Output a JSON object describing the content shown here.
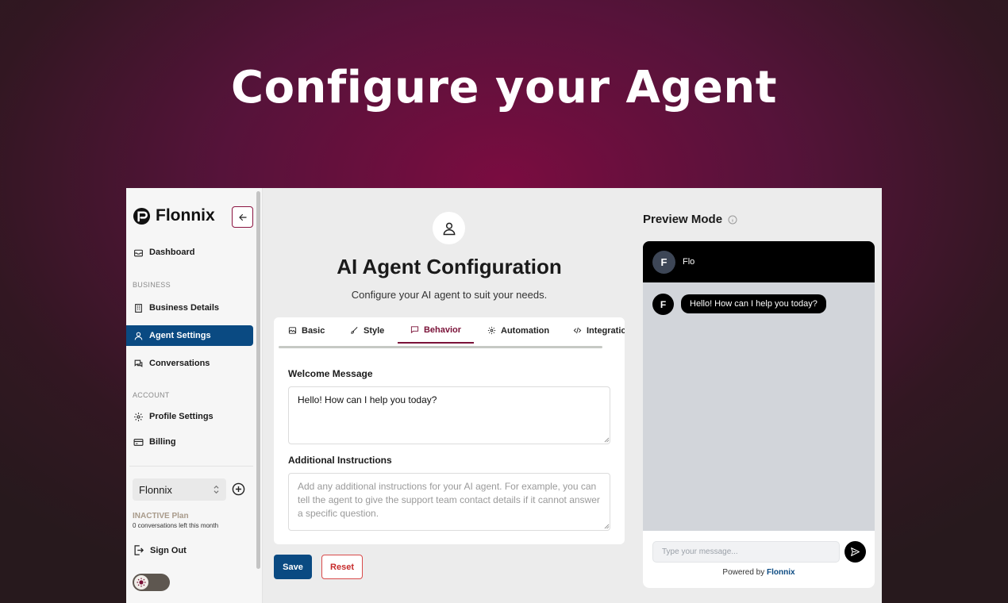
{
  "hero": {
    "title": "Configure your Agent"
  },
  "sidebar": {
    "brand": "Flonnix",
    "dashboard": "Dashboard",
    "business_section": "BUSINESS",
    "business_details": "Business Details",
    "agent_settings": "Agent Settings",
    "conversations": "Conversations",
    "account_section": "ACCOUNT",
    "profile_settings": "Profile Settings",
    "billing": "Billing",
    "org_selected": "Flonnix",
    "plan_name": "INACTIVE Plan",
    "plan_sub": "0 conversations left this month",
    "sign_out": "Sign Out"
  },
  "main": {
    "title": "AI Agent Configuration",
    "subtitle": "Configure your AI agent to suit your needs.",
    "tabs": [
      {
        "label": "Basic",
        "icon": "image-icon"
      },
      {
        "label": "Style",
        "icon": "brush-icon"
      },
      {
        "label": "Behavior",
        "icon": "message-icon",
        "active": true
      },
      {
        "label": "Automation",
        "icon": "gear-icon"
      },
      {
        "label": "Integratio",
        "icon": "code-icon"
      }
    ],
    "welcome_label": "Welcome Message",
    "welcome_value": "Hello! How can I help you today?",
    "instructions_label": "Additional Instructions",
    "instructions_placeholder": "Add any additional instructions for your AI agent. For example, you can tell the agent to give the support team contact details if it cannot answer a specific question.",
    "save_label": "Save",
    "reset_label": "Reset"
  },
  "preview": {
    "title": "Preview Mode",
    "agent_initial": "F",
    "agent_name": "Flo",
    "message": "Hello! How can I help you today?",
    "input_placeholder": "Type your message...",
    "powered_prefix": "Powered by",
    "powered_brand": "Flonnix"
  },
  "colors": {
    "accent_blue": "#0a4a82",
    "accent_maroon": "#7a1238",
    "reset_red": "#c62b2b"
  }
}
